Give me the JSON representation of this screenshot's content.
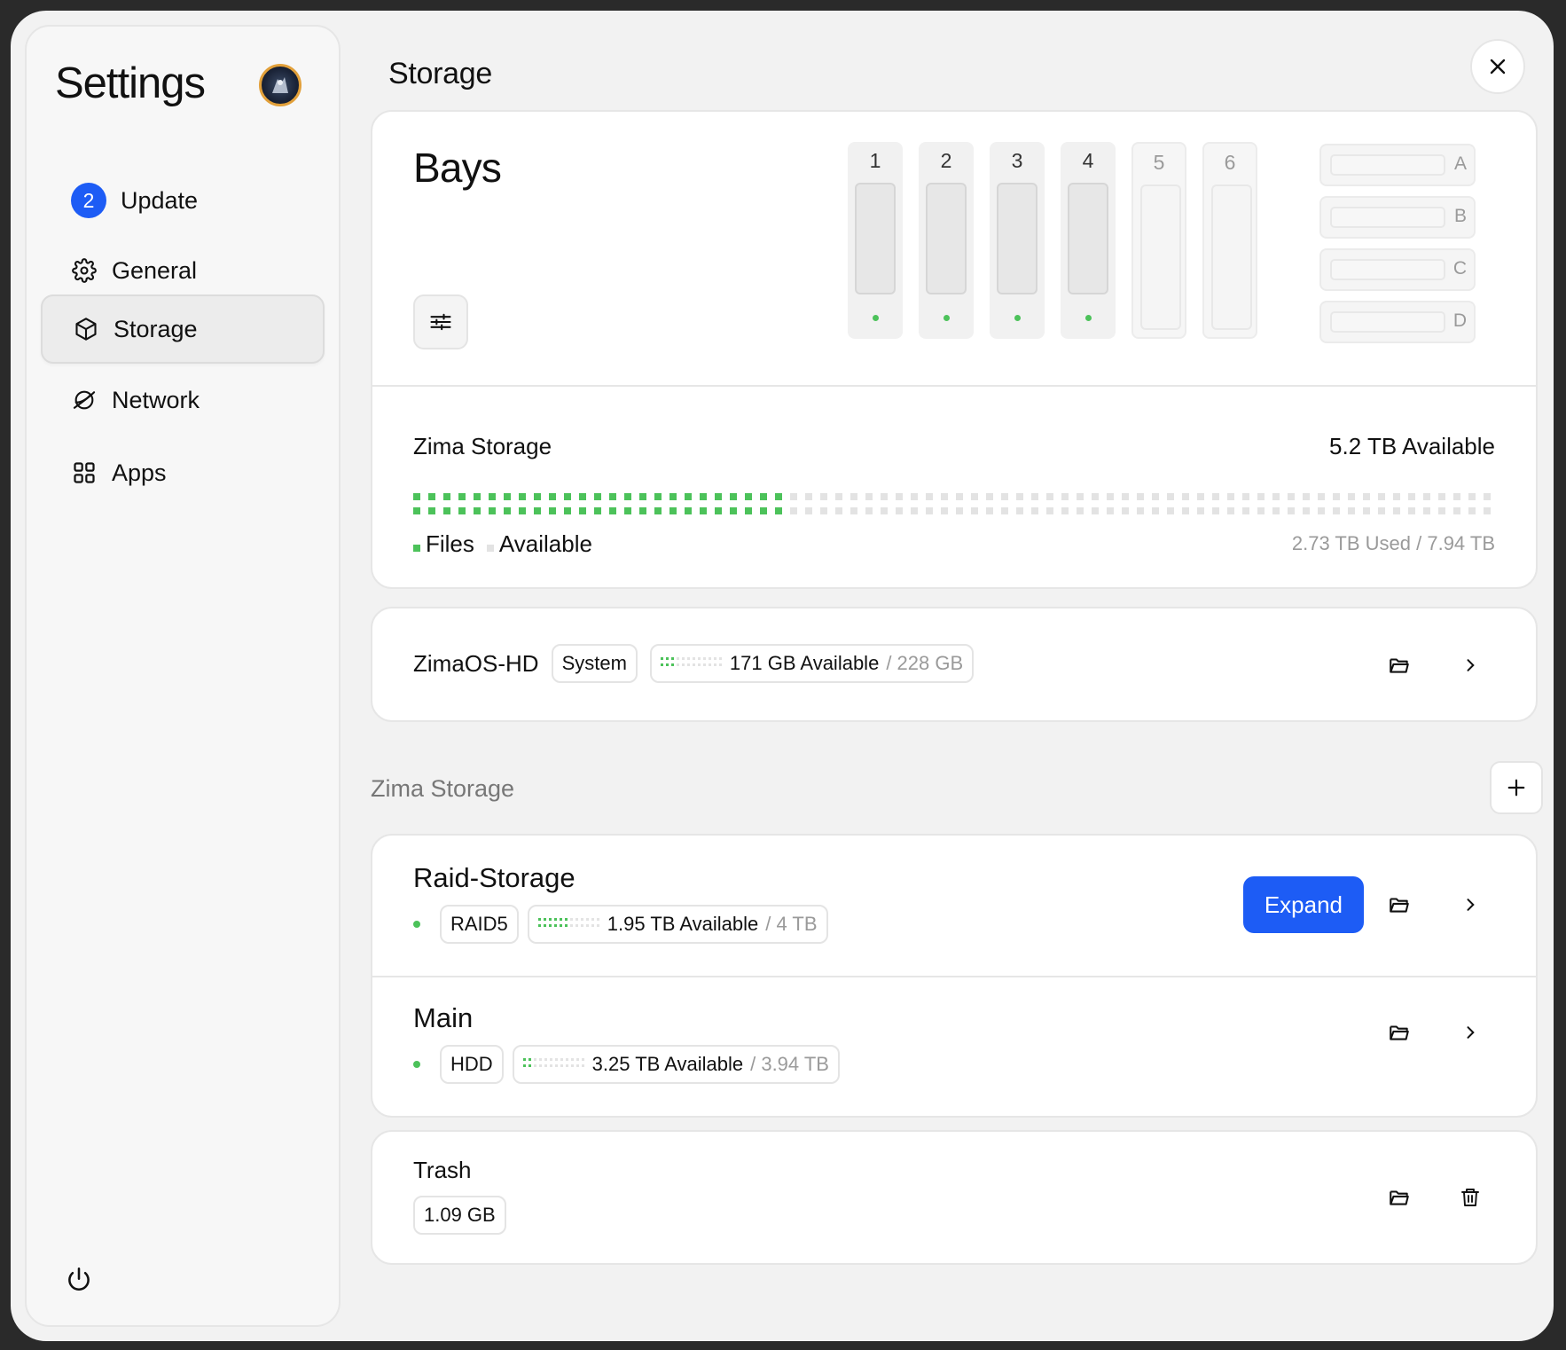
{
  "sidebar": {
    "title": "Settings",
    "update": {
      "count": "2",
      "label": "Update"
    },
    "items": [
      {
        "label": "General",
        "icon": "gear-icon"
      },
      {
        "label": "Storage",
        "icon": "cube-icon",
        "active": true
      },
      {
        "label": "Network",
        "icon": "globe-icon"
      },
      {
        "label": "Apps",
        "icon": "grid-icon"
      }
    ]
  },
  "main": {
    "title": "Storage",
    "bays": {
      "title": "Bays",
      "slots": [
        {
          "num": "1",
          "occupied": true
        },
        {
          "num": "2",
          "occupied": true
        },
        {
          "num": "3",
          "occupied": true
        },
        {
          "num": "4",
          "occupied": true
        },
        {
          "num": "5",
          "occupied": false
        },
        {
          "num": "6",
          "occupied": false
        }
      ],
      "m2": [
        "A",
        "B",
        "C",
        "D"
      ]
    },
    "zima_storage": {
      "name": "Zima Storage",
      "available": "5.2 TB Available",
      "used_fraction": 0.344,
      "legend_files": "Files",
      "legend_available": "Available",
      "used_total": "2.73 TB Used / 7.94 TB"
    },
    "system_disk": {
      "name": "ZimaOS-HD",
      "tag": "System",
      "available": "171 GB Available",
      "total": "/ 228 GB",
      "used_fraction": 0.25
    },
    "section_label": "Zima Storage",
    "pools": [
      {
        "name": "Raid-Storage",
        "type": "RAID5",
        "available": "1.95 TB Available",
        "total": "/ 4 TB",
        "used_fraction": 0.5,
        "action": "Expand"
      },
      {
        "name": "Main",
        "type": "HDD",
        "available": "3.25 TB Available",
        "total": "/ 3.94 TB",
        "used_fraction": 0.18
      }
    ],
    "trash": {
      "name": "Trash",
      "size": "1.09 GB"
    }
  },
  "colors": {
    "accent": "#1d5cf5",
    "green": "#4cc25a",
    "dot_empty": "#e3e3e3"
  }
}
